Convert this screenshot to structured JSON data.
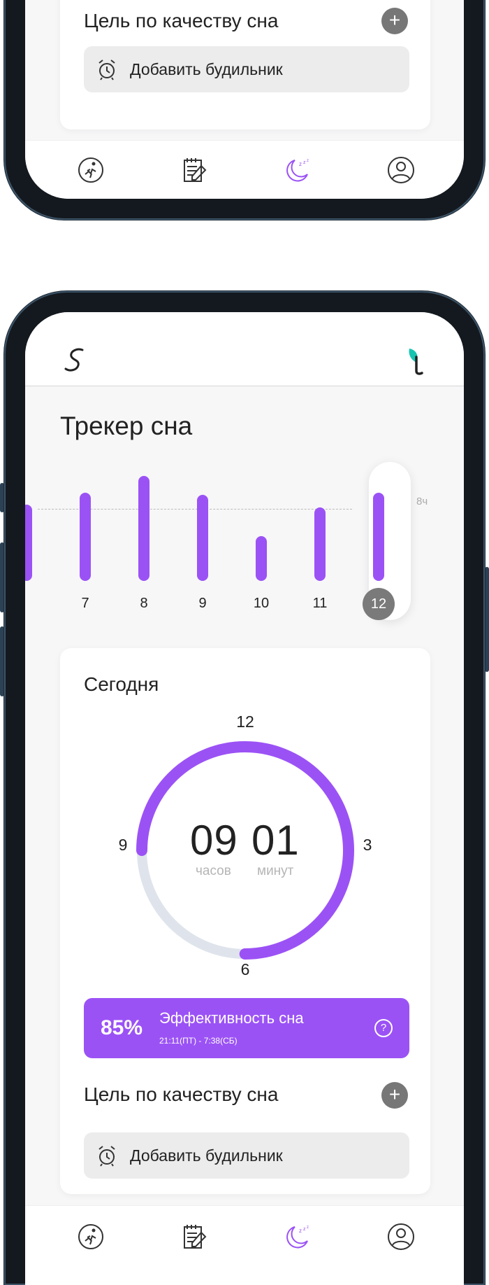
{
  "colors": {
    "accent": "#9b52f5",
    "frame": "#14191f",
    "track": "#dfe4ec"
  },
  "top": {
    "goal_title": "Цель по качеству сна",
    "alarm_label": "Добавить будильник",
    "add_icon": "plus-icon",
    "alarm_icon": "alarm-clock-icon"
  },
  "header": {
    "logo_icon": "app-logo-icon",
    "brand_icon": "brand-leaf-icon"
  },
  "tracker": {
    "title": "Трекер сна",
    "reference_label": "8ч",
    "reference_hours": 8,
    "days": [
      {
        "label": "",
        "hours": 7.3
      },
      {
        "label": "7",
        "hours": 8.4
      },
      {
        "label": "8",
        "hours": 10.0
      },
      {
        "label": "9",
        "hours": 8.2
      },
      {
        "label": "10",
        "hours": 4.3
      },
      {
        "label": "11",
        "hours": 7.0
      },
      {
        "label": "12",
        "hours": 8.4,
        "selected": true
      }
    ]
  },
  "today": {
    "title": "Сегодня",
    "clock_labels": {
      "top": "12",
      "right": "3",
      "bottom": "6",
      "left": "9"
    },
    "hours": "09",
    "minutes": "01",
    "hours_unit": "часов",
    "minutes_unit": "минут",
    "arc_fraction": 0.75
  },
  "efficiency": {
    "percent": "85%",
    "label": "Эффективность сна",
    "range": "21:11(ПТ) - 7:38(СБ)",
    "help_icon": "question-icon"
  },
  "bottom": {
    "goal_title": "Цель по качеству сна",
    "alarm_label": "Добавить будильник"
  },
  "nav": [
    {
      "name": "activity",
      "icon": "running-icon"
    },
    {
      "name": "journal",
      "icon": "notepad-icon"
    },
    {
      "name": "sleep",
      "icon": "moon-icon",
      "active": true
    },
    {
      "name": "profile",
      "icon": "user-icon"
    }
  ]
}
